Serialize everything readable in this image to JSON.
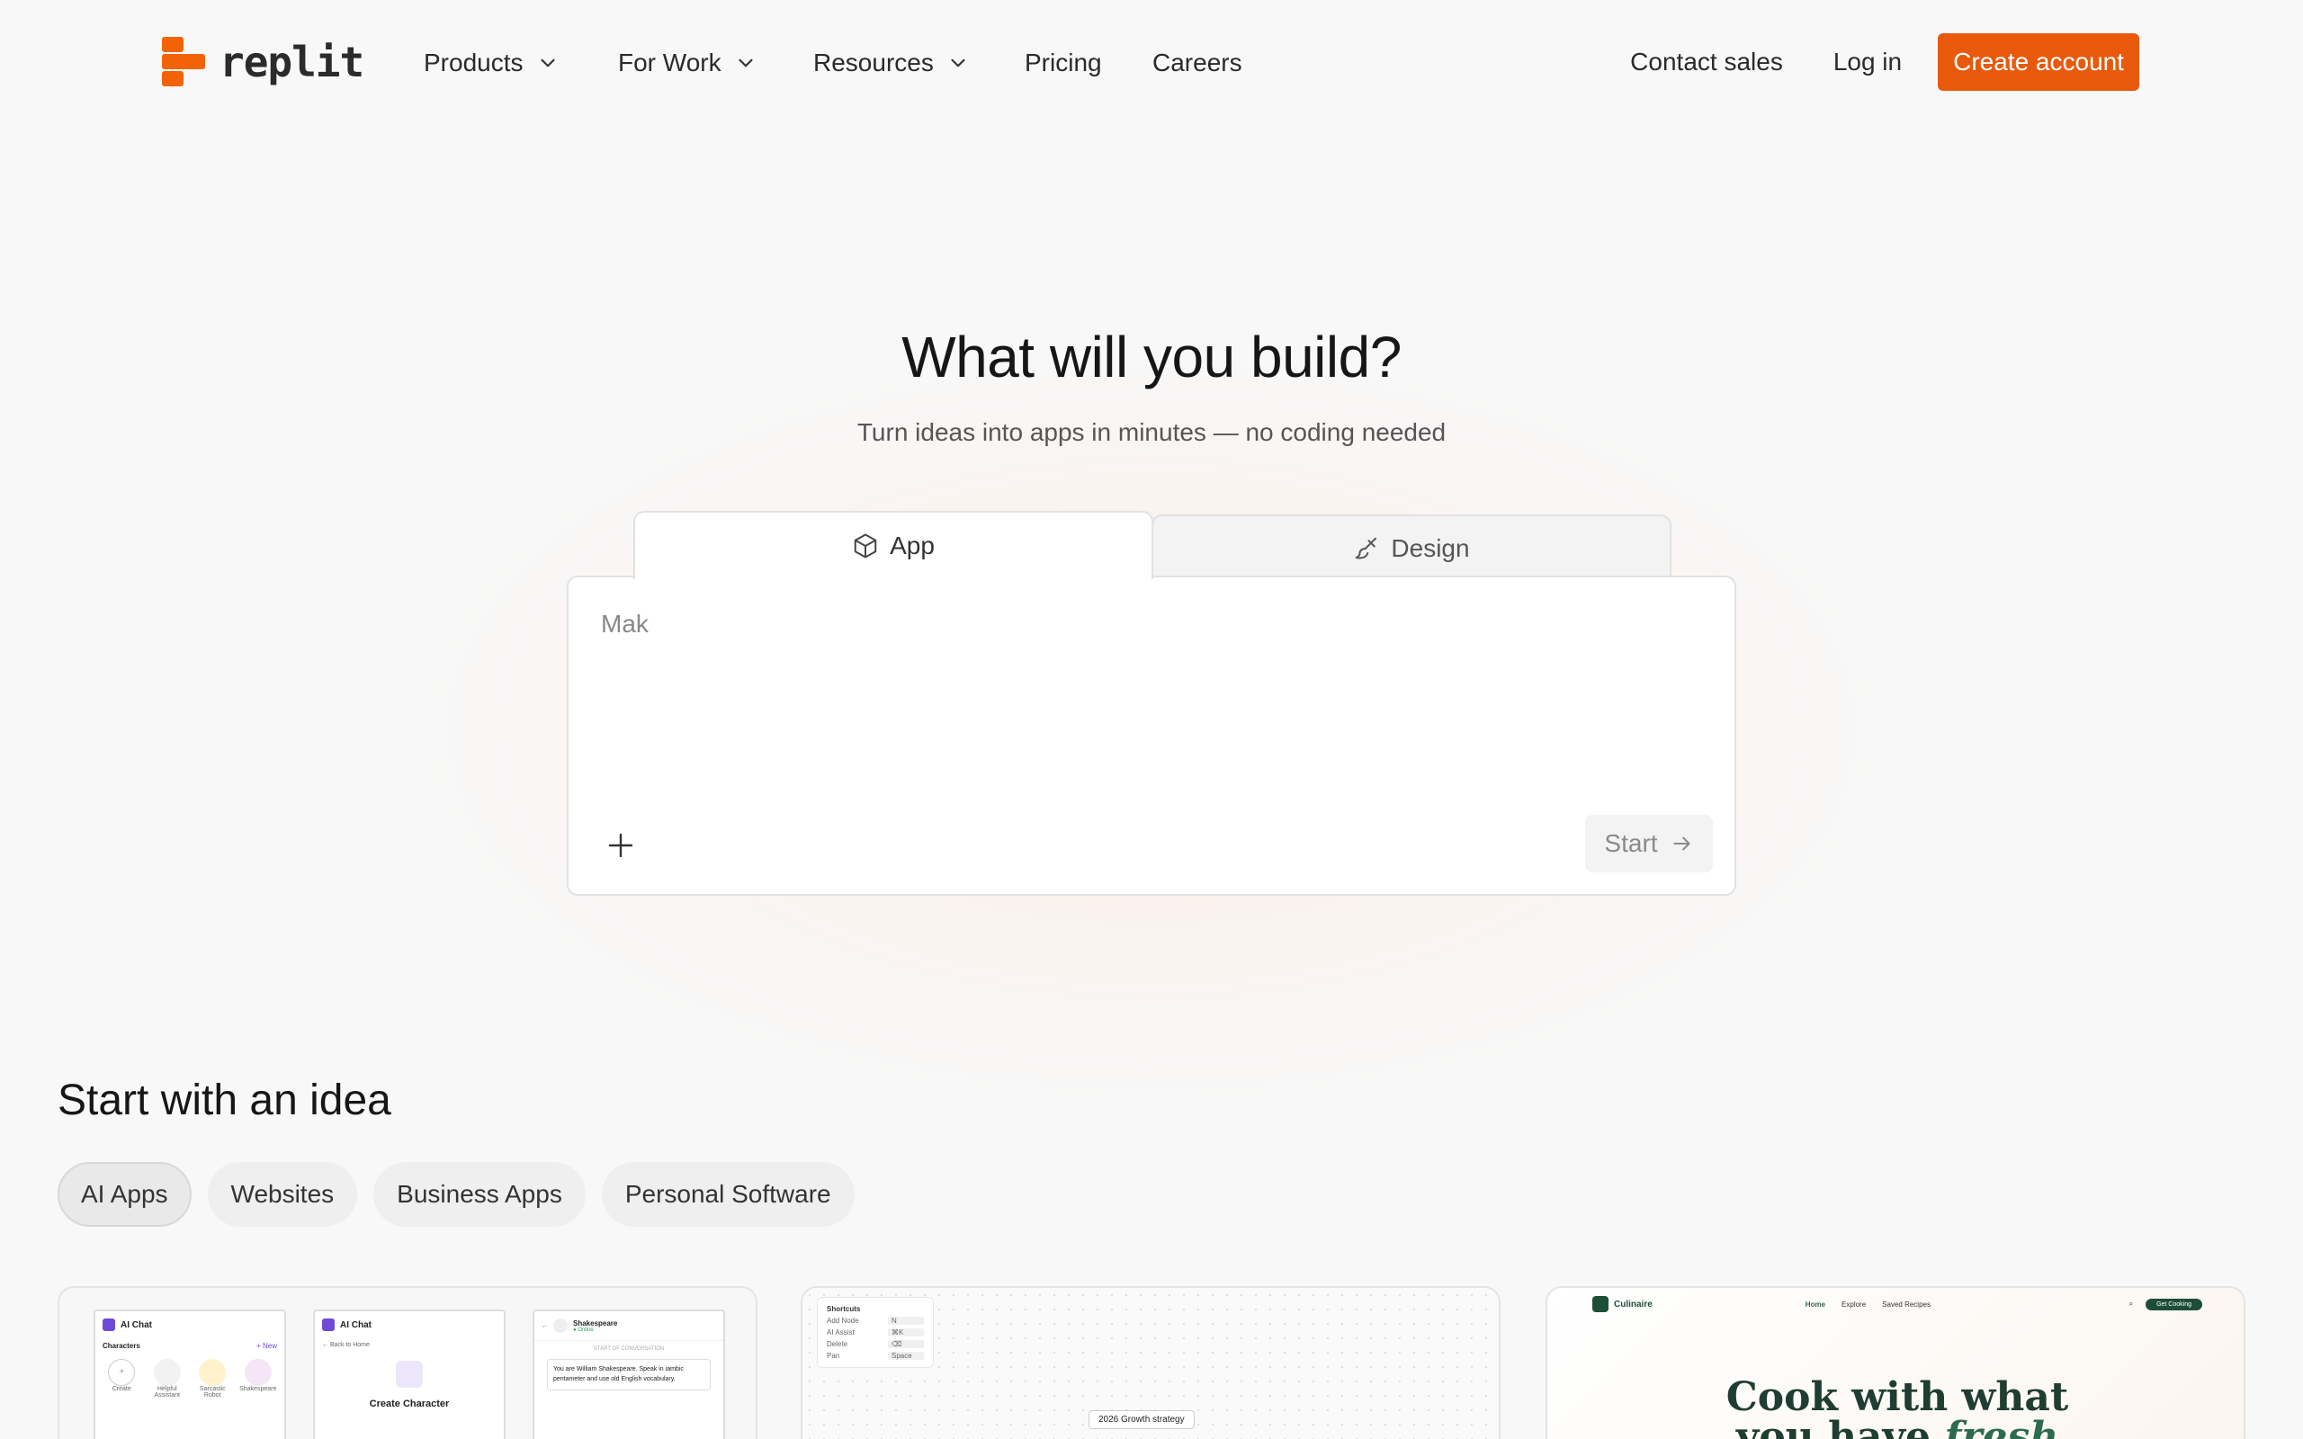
{
  "brand": {
    "name": "replit",
    "accent": "#f26207",
    "cta_color": "#e8590c"
  },
  "nav": {
    "items": [
      {
        "label": "Products",
        "dropdown": true
      },
      {
        "label": "For Work",
        "dropdown": true
      },
      {
        "label": "Resources",
        "dropdown": true
      },
      {
        "label": "Pricing",
        "dropdown": false
      },
      {
        "label": "Careers",
        "dropdown": false
      }
    ],
    "contact_sales": "Contact sales",
    "log_in": "Log in",
    "create_account": "Create account"
  },
  "hero": {
    "title": "What will you build?",
    "subtitle": "Turn ideas into apps in minutes — no coding needed",
    "tabs": [
      {
        "label": "App",
        "icon": "cube-icon",
        "active": true
      },
      {
        "label": "Design",
        "icon": "brush-icon",
        "active": false
      }
    ],
    "prompt_value": "Mak",
    "start_label": "Start"
  },
  "ideas": {
    "title": "Start with an idea",
    "chips": [
      {
        "label": "AI Apps",
        "active": true
      },
      {
        "label": "Websites",
        "active": false
      },
      {
        "label": "Business Apps",
        "active": false
      },
      {
        "label": "Personal Software",
        "active": false
      }
    ],
    "cards": {
      "ai_chat": {
        "app_name": "AI Chat",
        "characters_label": "Characters",
        "new_label": "+ New",
        "back_label": "← Back to Home",
        "create_character": "Create Character",
        "character_names": [
          "Create",
          "Helpful Assistant",
          "Sarcastic Robot",
          "Shakespeare"
        ],
        "chat_name": "Shakespeare",
        "chat_status": "● Online",
        "conversation_start": "START OF CONVERSATION",
        "chat_message": "You are William Shakespeare. Speak in iambic pentameter and use old English vocabulary."
      },
      "whiteboard": {
        "shortcuts_title": "Shortcuts",
        "shortcuts": [
          {
            "action": "Add Node",
            "key": "N"
          },
          {
            "action": "AI Assist",
            "key": "⌘K"
          },
          {
            "action": "Delete",
            "key": "⌫"
          },
          {
            "action": "Pan",
            "key": "Space"
          }
        ],
        "node_label": "2026 Growth strategy"
      },
      "culinaire": {
        "logo_text": "Culinaire",
        "links": [
          "Home",
          "Explore",
          "Saved Recipes"
        ],
        "cta": "Get Cooking",
        "headline_line1": "Cook with what",
        "headline_line2_prefix": "you have",
        "headline_line2_emph": "fresh"
      }
    }
  }
}
